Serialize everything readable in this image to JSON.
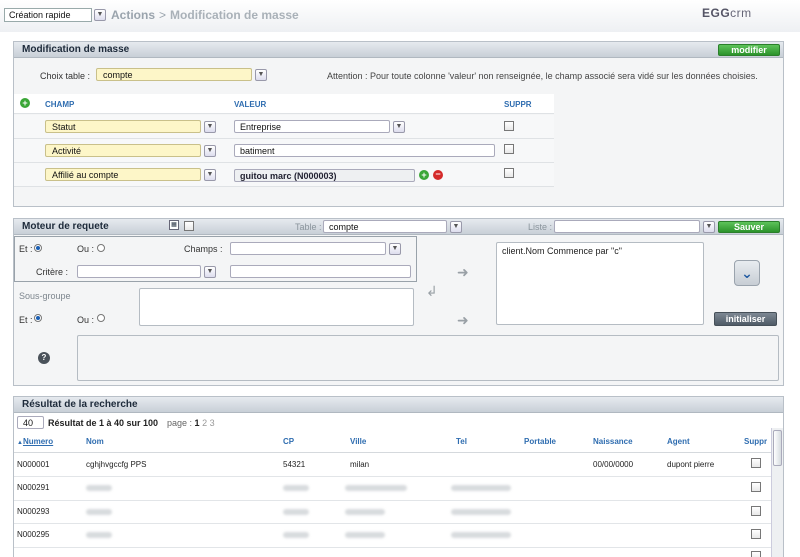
{
  "topbar": {
    "quick_select": "Création rapide",
    "breadcrumb": [
      "Actions",
      "Modification de masse"
    ],
    "logo_main": "EGG",
    "logo_sub": "crm"
  },
  "mass_edit": {
    "title": "Modification de masse",
    "modify_button": "modifier",
    "choose_table_label": "Choix table :",
    "choose_table_value": "compte",
    "warning": "Attention : Pour toute colonne 'valeur' non renseignée, le champ associé sera vidé sur les données choisies.",
    "col_champ": "CHAMP",
    "col_valeur": "VALEUR",
    "col_suppr": "SUPPR",
    "rows": [
      {
        "champ": "Statut",
        "valeur": "Entreprise"
      },
      {
        "champ": "Activité",
        "valeur": "batiment"
      },
      {
        "champ": "Affilié au compte",
        "valeur": "guitou marc (N000003)"
      }
    ]
  },
  "query": {
    "title": "Moteur de requete",
    "table_label": "Table :",
    "table_value": "compte",
    "list_label": "Liste :",
    "list_value": "",
    "save_button": "Sauver",
    "et_label": "Et :",
    "ou_label": "Ou :",
    "champs_label": "Champs :",
    "critere_label": "Critère :",
    "subgroup_label": "Sous-groupe",
    "query_text": "client.Nom Commence par \"c\"",
    "init_button": "initialiser",
    "help_icon": "?"
  },
  "results": {
    "title": "Résultat de la recherche",
    "per_page": "40",
    "summary": "Résultat de 1 à 40 sur 100",
    "page_label": "page :",
    "pages": [
      "1",
      "2",
      "3"
    ],
    "columns": [
      "Numero",
      "Nom",
      "CP",
      "Ville",
      "Tel",
      "Portable",
      "Naissance",
      "Agent",
      "Suppr"
    ],
    "rows": [
      {
        "numero": "N000001",
        "nom": "cghjhvgccfg PPS",
        "cp": "54321",
        "ville": "milan",
        "naissance": "00/00/0000",
        "agent": "dupont pierre"
      },
      {
        "numero": "N000291"
      },
      {
        "numero": "N000293"
      },
      {
        "numero": "N000295"
      }
    ]
  }
}
